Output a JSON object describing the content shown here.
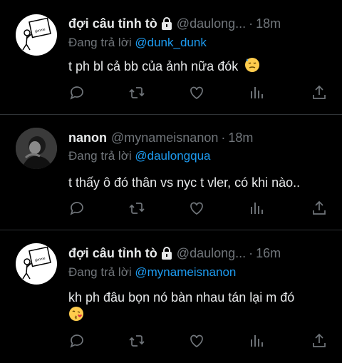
{
  "tweets": [
    {
      "name": "đợi câu tỉnh tò",
      "locked": true,
      "handle": "@daulong...",
      "dot": "·",
      "time": "18m",
      "reply_prefix": "Đang trả lời",
      "reply_to": "@dunk_dunk",
      "text": "t ph bl cả bb của ảnh nữa đók",
      "emoji": "sweat-face-icon",
      "avatar_sign_text": "gimme"
    },
    {
      "name": "nanon",
      "locked": false,
      "handle": "@mynameisnanon",
      "dot": "·",
      "time": "18m",
      "reply_prefix": "Đang trả lời",
      "reply_to": "@daulongqua",
      "text": "t thấy ô đó thân vs nyc t vler, có khi nào..",
      "emoji": "",
      "avatar_sign_text": ""
    },
    {
      "name": "đợi câu tỉnh tò",
      "locked": true,
      "handle": "@daulong...",
      "dot": "·",
      "time": "16m",
      "reply_prefix": "Đang trả lời",
      "reply_to": "@mynameisnanon",
      "text": "kh ph đâu bọn nó bàn nhau tán lại m đó",
      "emoji": "kissing-face-icon",
      "avatar_sign_text": "gimme"
    }
  ],
  "icons": {
    "reply": "reply-icon",
    "retweet": "retweet-icon",
    "like": "heart-icon",
    "views": "views-icon",
    "share": "share-icon"
  },
  "colors": {
    "background": "#000000",
    "text": "#e7e9ea",
    "muted": "#71767b",
    "link": "#1d9bf0",
    "divider": "#2f3336"
  }
}
